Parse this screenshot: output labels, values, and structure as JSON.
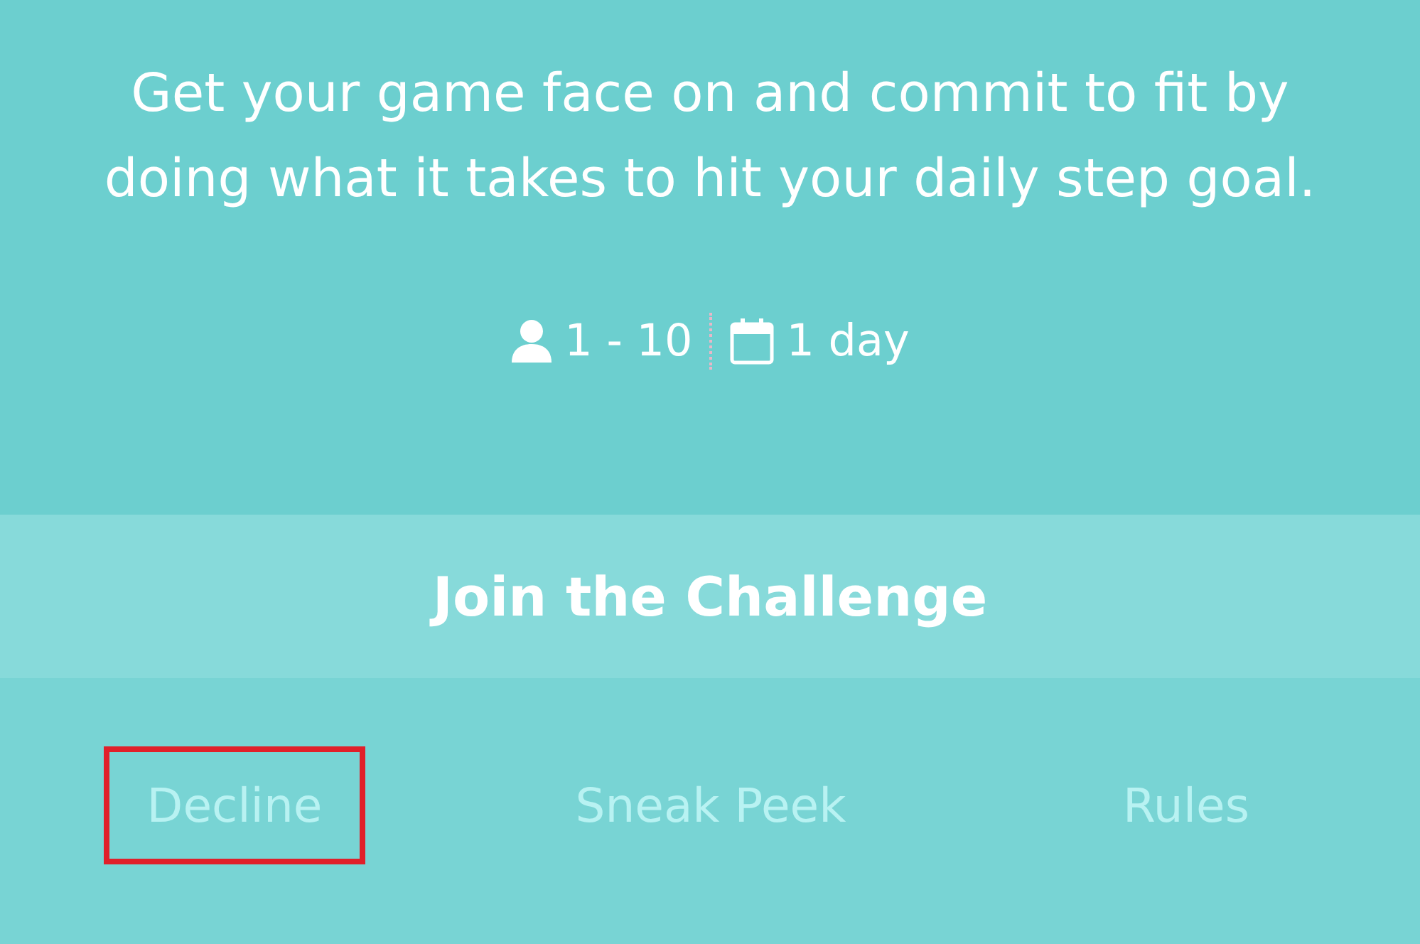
{
  "description": "Get your game face on and commit to fit by doing what it takes to hit your daily step goal.",
  "meta": [
    {
      "kind": "participants",
      "text": "1 - 10"
    },
    {
      "kind": "duration",
      "text": "1 day"
    }
  ],
  "join_button": "Join the Challenge",
  "links": [
    {
      "label": "Decline",
      "highlighted": true
    },
    {
      "label": "Sneak Peek",
      "highlighted": false
    },
    {
      "label": "Rules",
      "highlighted": false
    }
  ]
}
